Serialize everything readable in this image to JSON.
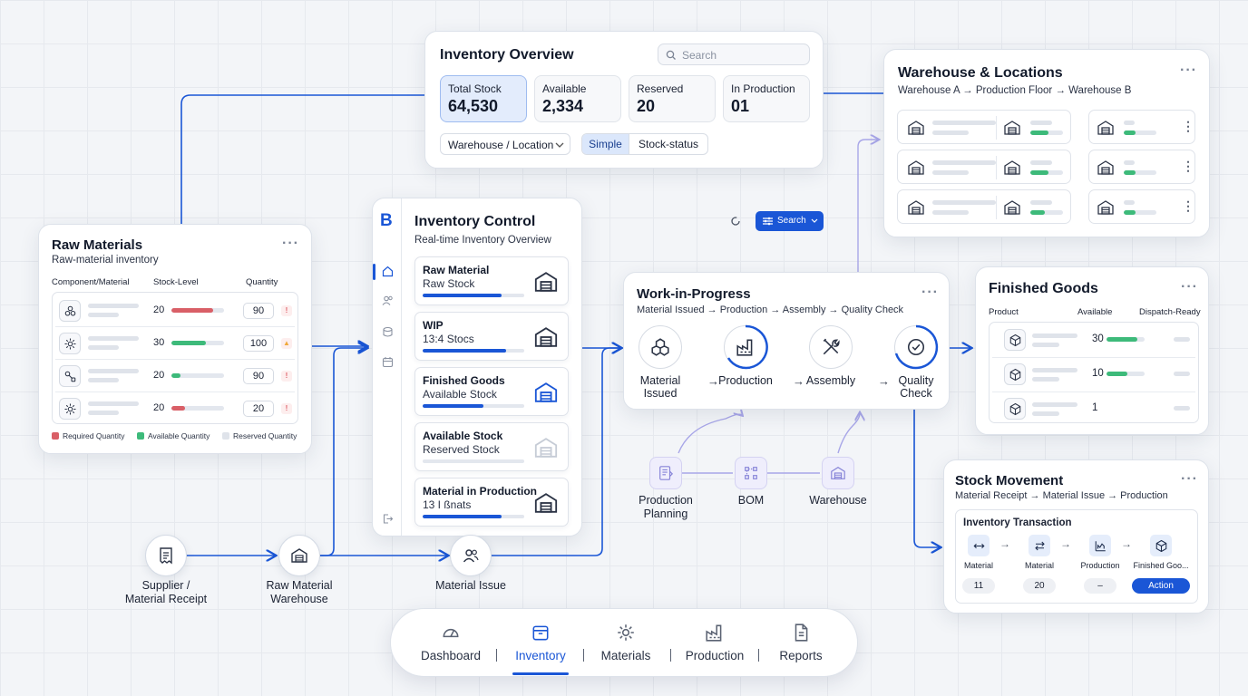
{
  "overview": {
    "title": "Inventory Overview",
    "search_placeholder": "Search",
    "stats": [
      {
        "label": "Total Stock",
        "value": "64,530"
      },
      {
        "label": "Available",
        "value": "2,334"
      },
      {
        "label": "Reserved",
        "value": "20"
      },
      {
        "label": "In Production",
        "value": "01"
      }
    ],
    "filter": "Warehouse / Location",
    "views": [
      "Simple",
      "Stock-status"
    ]
  },
  "warehouse": {
    "title": "Warehouse & Locations",
    "subtitle": "Warehouse A → Production Floor → Warehouse B",
    "levels": [
      0.55,
      0.55,
      0.45
    ]
  },
  "raw": {
    "title": "Raw Materials",
    "subtitle": "Raw-material inventory",
    "columns": [
      "Component/Material",
      "Stock-Level",
      "Quantity"
    ],
    "rows": [
      {
        "icon": "molecule-icon",
        "level": 20,
        "fill": 0.8,
        "color": "#d95f67",
        "qty": "90",
        "alert": "!",
        "alert_color": "#e0636b"
      },
      {
        "icon": "gear-icon",
        "level": 30,
        "fill": 0.65,
        "color": "#3dba7a",
        "qty": "100",
        "alert": "▲",
        "alert_color": "#f0a93b"
      },
      {
        "icon": "part-icon",
        "level": 20,
        "fill": 0.18,
        "color": "#3dba7a",
        "qty": "90",
        "alert": "!",
        "alert_color": "#e0636b"
      },
      {
        "icon": "gear-icon",
        "level": 20,
        "fill": 0.25,
        "color": "#d95f67",
        "qty": "20",
        "alert": "!",
        "alert_color": "#e0636b"
      }
    ],
    "legend": [
      {
        "label": "Required Quantity",
        "color": "#d95f67"
      },
      {
        "label": "Available Quantity",
        "color": "#3dba7a"
      },
      {
        "label": "Reserved Quantity",
        "color": "#dfe3ea"
      }
    ]
  },
  "control": {
    "logo": "B",
    "title": "Inventory Control",
    "subtitle": "Real-time Inventory Overview",
    "items": [
      {
        "title": "Raw Material",
        "sub": "Raw Stock",
        "fill": 0.78
      },
      {
        "title": "WIP",
        "sub": "13:4 Stocs",
        "fill": 0.82
      },
      {
        "title": "Finished Goods",
        "sub": "Available Stock",
        "fill": 0.6
      },
      {
        "title": "Available Stock",
        "sub": "Reserved Stock",
        "fill": 0
      },
      {
        "title": "Material in Production",
        "sub": "13 I ßnats",
        "fill": 0.78
      }
    ]
  },
  "toolbar": {
    "search_label": "Search"
  },
  "wip": {
    "title": "Work-in-Progress",
    "subtitle": "Material Issued → Production → Assembly → Quality Check",
    "steps": [
      {
        "label": "Material\nIssued",
        "icon": "boxes-icon"
      },
      {
        "label": "Production",
        "icon": "factory-icon"
      },
      {
        "label": "Assembly",
        "icon": "tools-icon"
      },
      {
        "label": "Quality\nCheck",
        "icon": "check-icon"
      }
    ]
  },
  "planning": {
    "nodes": [
      "Production\nPlanning",
      "BOM",
      "Warehouse"
    ]
  },
  "finished": {
    "title": "Finished Goods",
    "columns": [
      "Product",
      "Available",
      "Dispatch-Ready"
    ],
    "rows": [
      {
        "value": "30",
        "fill": 0.82
      },
      {
        "value": "10",
        "fill": 0.55
      },
      {
        "value": "1",
        "fill": 0
      }
    ]
  },
  "movement": {
    "title": "Stock Movement",
    "subtitle": "Material Receipt → Material Issue → Production",
    "tx_title": "Inventory Transaction",
    "steps": [
      {
        "label": "Material",
        "value": "11"
      },
      {
        "label": "Material",
        "value": "20"
      },
      {
        "label": "Production",
        "value": "–"
      },
      {
        "label": "Finished Goo...",
        "value": "Action"
      }
    ]
  },
  "flow": {
    "supplier": "Supplier /\nMaterial Receipt",
    "rawwh": "Raw Material\nWarehouse",
    "issue": "Material Issue"
  },
  "nav": {
    "items": [
      "Dashboard",
      "Inventory",
      "Materials",
      "Production",
      "Reports"
    ],
    "active": 1
  },
  "colors": {
    "accent": "#1a56d6",
    "red": "#d95f67",
    "green": "#3dba7a"
  }
}
